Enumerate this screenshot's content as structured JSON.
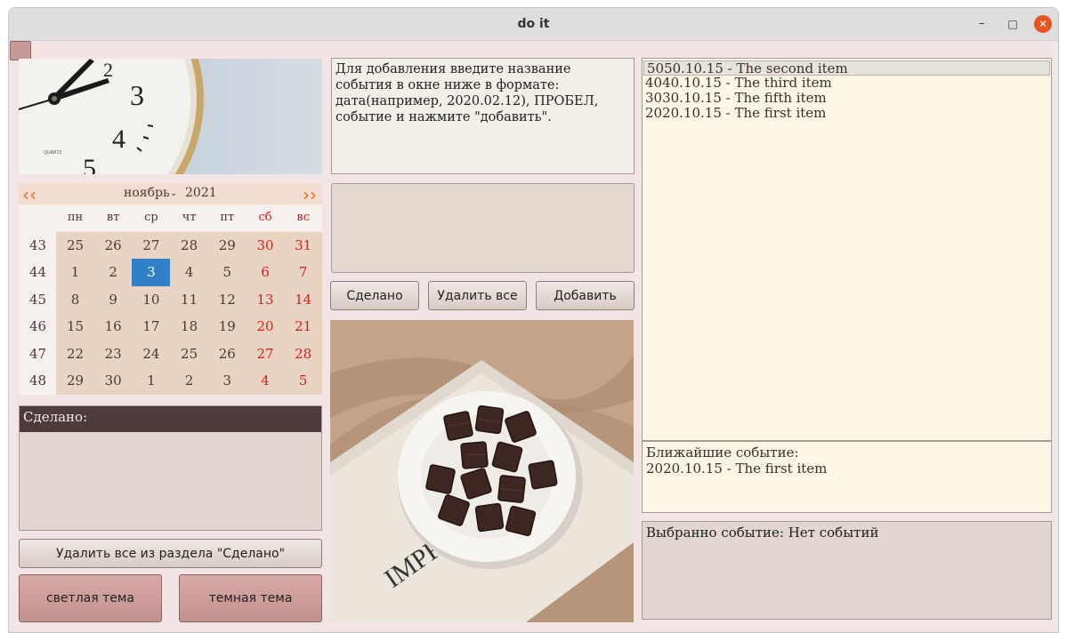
{
  "window": {
    "title": "do it",
    "controls": {
      "minimize": "–",
      "maximize": "□",
      "close": "✕"
    }
  },
  "calendar": {
    "prev_icon": "‹‹",
    "next_icon": "››",
    "month": "ноябрь",
    "month_dropdown_icon": "⌄",
    "year": "2021",
    "days_of_week": [
      "пн",
      "вт",
      "ср",
      "чт",
      "пт",
      "сб",
      "вс"
    ],
    "weeks": [
      {
        "num": "43",
        "days": [
          "25",
          "26",
          "27",
          "28",
          "29",
          "30",
          "31"
        ]
      },
      {
        "num": "44",
        "days": [
          "1",
          "2",
          "3",
          "4",
          "5",
          "6",
          "7"
        ]
      },
      {
        "num": "45",
        "days": [
          "8",
          "9",
          "10",
          "11",
          "12",
          "13",
          "14"
        ]
      },
      {
        "num": "46",
        "days": [
          "15",
          "16",
          "17",
          "18",
          "19",
          "20",
          "21"
        ]
      },
      {
        "num": "47",
        "days": [
          "22",
          "23",
          "24",
          "25",
          "26",
          "27",
          "28"
        ]
      },
      {
        "num": "48",
        "days": [
          "29",
          "30",
          "1",
          "2",
          "3",
          "4",
          "5"
        ]
      }
    ],
    "selected_day": "3",
    "accent_color": "#2f80c8",
    "weekend_color": "#d42020"
  },
  "done_panel": {
    "header": "Сделано:"
  },
  "buttons": {
    "delete_done": "Удалить все из раздела \"Сделано\"",
    "light_theme": "светлая тема",
    "dark_theme": "темная тема",
    "done": "Сделано",
    "delete_all": "Удалить все",
    "add": "Добавить"
  },
  "instructions": "Для добавления введите название события в окне ниже в формате: дата(например, 2020.02.12), ПРОБЕЛ, событие и нажмите \"добавить\".",
  "input": {
    "value": ""
  },
  "events": [
    "5050.10.15 - The second item",
    "4040.10.15 - The third item",
    "3030.10.15 - The fifth item",
    "2020.10.15 - The first item"
  ],
  "nearest": {
    "label": "Ближайшие событие:",
    "value": "2020.10.15 - The first item"
  },
  "selected_event": {
    "label": "Выбранно событие: Нет событий"
  },
  "photo_chocolate_text": "IMPR"
}
